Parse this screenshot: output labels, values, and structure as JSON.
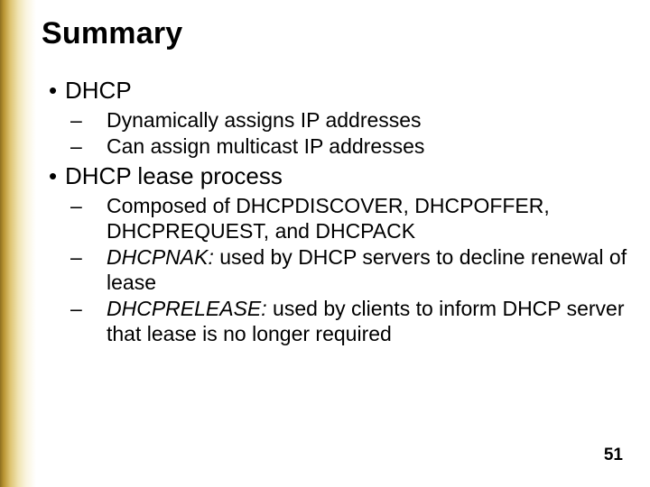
{
  "title": "Summary",
  "page_number": "51",
  "bullets": {
    "b1": "DHCP",
    "b1_1": "Dynamically assigns IP addresses",
    "b1_2": "Can assign multicast IP addresses",
    "b2": "DHCP lease process",
    "b2_1": "Composed of DHCPDISCOVER, DHCPOFFER, DHCPREQUEST, and DHCPACK",
    "b2_2_term": "DHCPNAK:",
    "b2_2_rest": " used by DHCP servers to decline renewal of lease",
    "b2_3_term": "DHCPRELEASE:",
    "b2_3_rest": " used by clients to inform DHCP server that lease is no longer required"
  }
}
